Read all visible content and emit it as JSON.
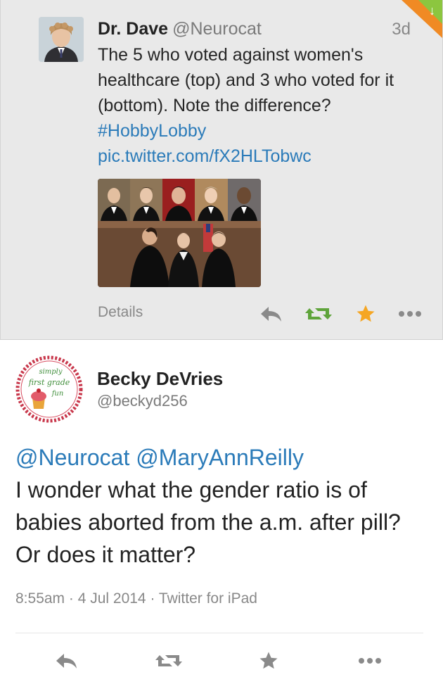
{
  "top_tweet": {
    "name": "Dr. Dave",
    "handle": "@Neurocat",
    "time": "3d",
    "text": "The 5 who voted against women's healthcare (top) and 3 who voted for it (bottom). Note the difference?",
    "hashtag": "#HobbyLobby",
    "pic_link": "pic.twitter.com/fX2HLTobwc",
    "details_label": "Details",
    "actions": [
      "reply-icon",
      "retweet-icon",
      "favorite-icon",
      "more-icon"
    ],
    "colors": {
      "retweet": "#5fa43b",
      "favorite": "#f5a623",
      "link": "#2b7bb9"
    }
  },
  "main_tweet": {
    "name": "Becky DeVries",
    "handle": "@beckyd256",
    "avatar_text": [
      "simply",
      "first grade",
      "fun"
    ],
    "mention1": "@Neurocat",
    "mention2": "@MaryAnnReilly",
    "text": "I wonder what the gender ratio is of babies aborted from the a.m. after pill?  Or does it matter?",
    "meta": "8:55am · 4 Jul 2014 · Twitter for iPad",
    "actions": [
      "reply-icon",
      "retweet-icon",
      "favorite-icon",
      "more-icon"
    ]
  }
}
